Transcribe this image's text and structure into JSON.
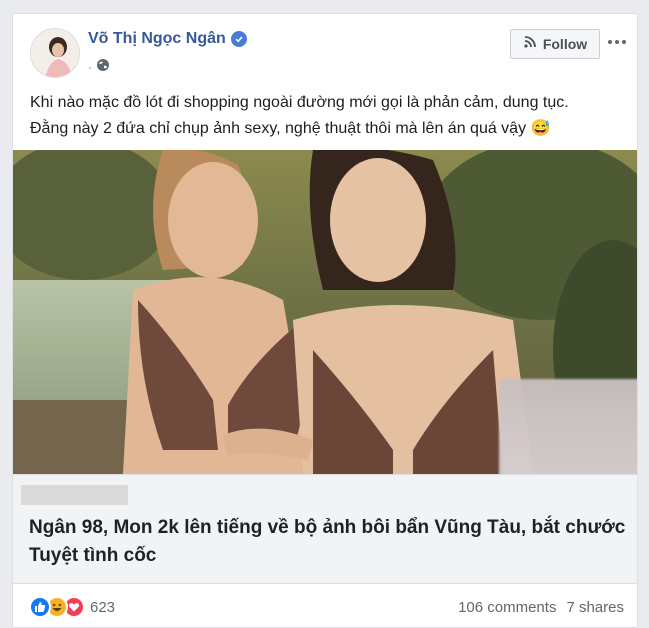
{
  "post": {
    "author": "Võ Thị Ngọc Ngân",
    "meta_dot": "·",
    "follow_label": "Follow",
    "text_lines": [
      "Khi nào mặc đồ lót đi shopping ngoài đường mới gọi là phản cảm, dung tục.",
      "Đằng này 2 đứa chỉ chụp ảnh sexy, nghệ thuật thôi mà lên án quá vậy 😅"
    ]
  },
  "link": {
    "title": "Ngân 98, Mon 2k lên tiếng về bộ ảnh bôi bẩn Vũng Tàu, bắt chước Tuyệt tình cốc"
  },
  "footer": {
    "reaction_count": "623",
    "comments": "106 comments",
    "shares": "7 shares"
  },
  "icons": {
    "verified": "verified-badge-icon",
    "privacy": "globe-icon",
    "follow": "rss-icon",
    "more": "more-options-icon",
    "reactions": [
      "like-reaction-icon",
      "haha-reaction-icon",
      "love-reaction-icon"
    ]
  },
  "colors": {
    "author_link": "#385898",
    "verified": "#4a7bd6",
    "like": "#1877f2",
    "haha": "#f7b125",
    "love": "#f33e58"
  }
}
